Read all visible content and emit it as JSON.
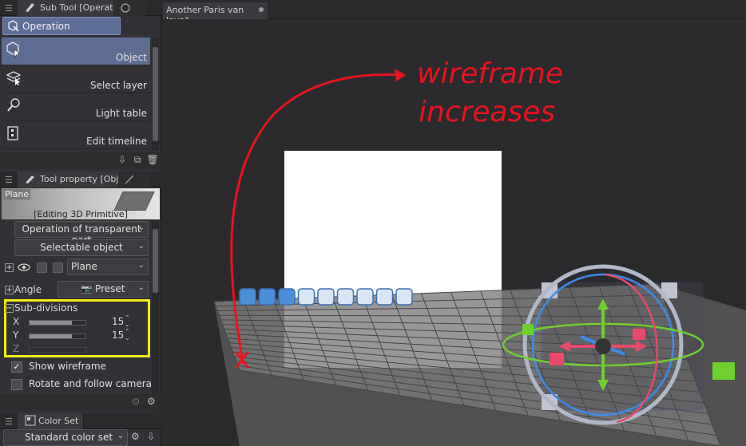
{
  "subtool_panel": {
    "tab_label": "Sub Tool [Operation]",
    "group_label": "Operation",
    "tools": [
      {
        "label": "Object",
        "icon": "object-cursor-icon",
        "selected": true
      },
      {
        "label": "Select layer",
        "icon": "select-layer-icon",
        "selected": false
      },
      {
        "label": "Light table",
        "icon": "light-table-icon",
        "selected": false
      },
      {
        "label": "Edit timeline",
        "icon": "edit-timeline-icon",
        "selected": false
      }
    ]
  },
  "tool_property": {
    "tab_label": "Tool property [Object]",
    "preview_tag": "Plane",
    "preview_caption": "[Editing 3D Primitive]",
    "transparent_mode": "Operation of transparent part",
    "selectable": "Selectable object",
    "object_name": "Plane",
    "angle_label": "Angle",
    "preset_label": "Preset",
    "subdivisions_label": "Sub-divisions",
    "axes": [
      {
        "label": "X",
        "value": "15",
        "level": 0.75
      },
      {
        "label": "Y",
        "value": "15",
        "level": 0.75
      },
      {
        "label": "Z",
        "value": "",
        "level": 0
      }
    ],
    "show_wireframe_label": "Show wireframe",
    "show_wireframe_checked": true,
    "rotate_label": "Rotate and follow camera",
    "rotate_checked": false
  },
  "color_set": {
    "tab_label": "Color Set",
    "selected": "Standard color set"
  },
  "canvas": {
    "doc_tab": "Another Paris van Java*",
    "annotation_line1": "wireframe",
    "annotation_line2": "increases",
    "annotation_color": "#e8141e",
    "highlight_color": "#f3ea17",
    "gizmo_colors": {
      "x": "#e84a6a",
      "y": "#6fcf2e",
      "z": "#3b8be8",
      "ring": "#b0b8c8"
    }
  }
}
